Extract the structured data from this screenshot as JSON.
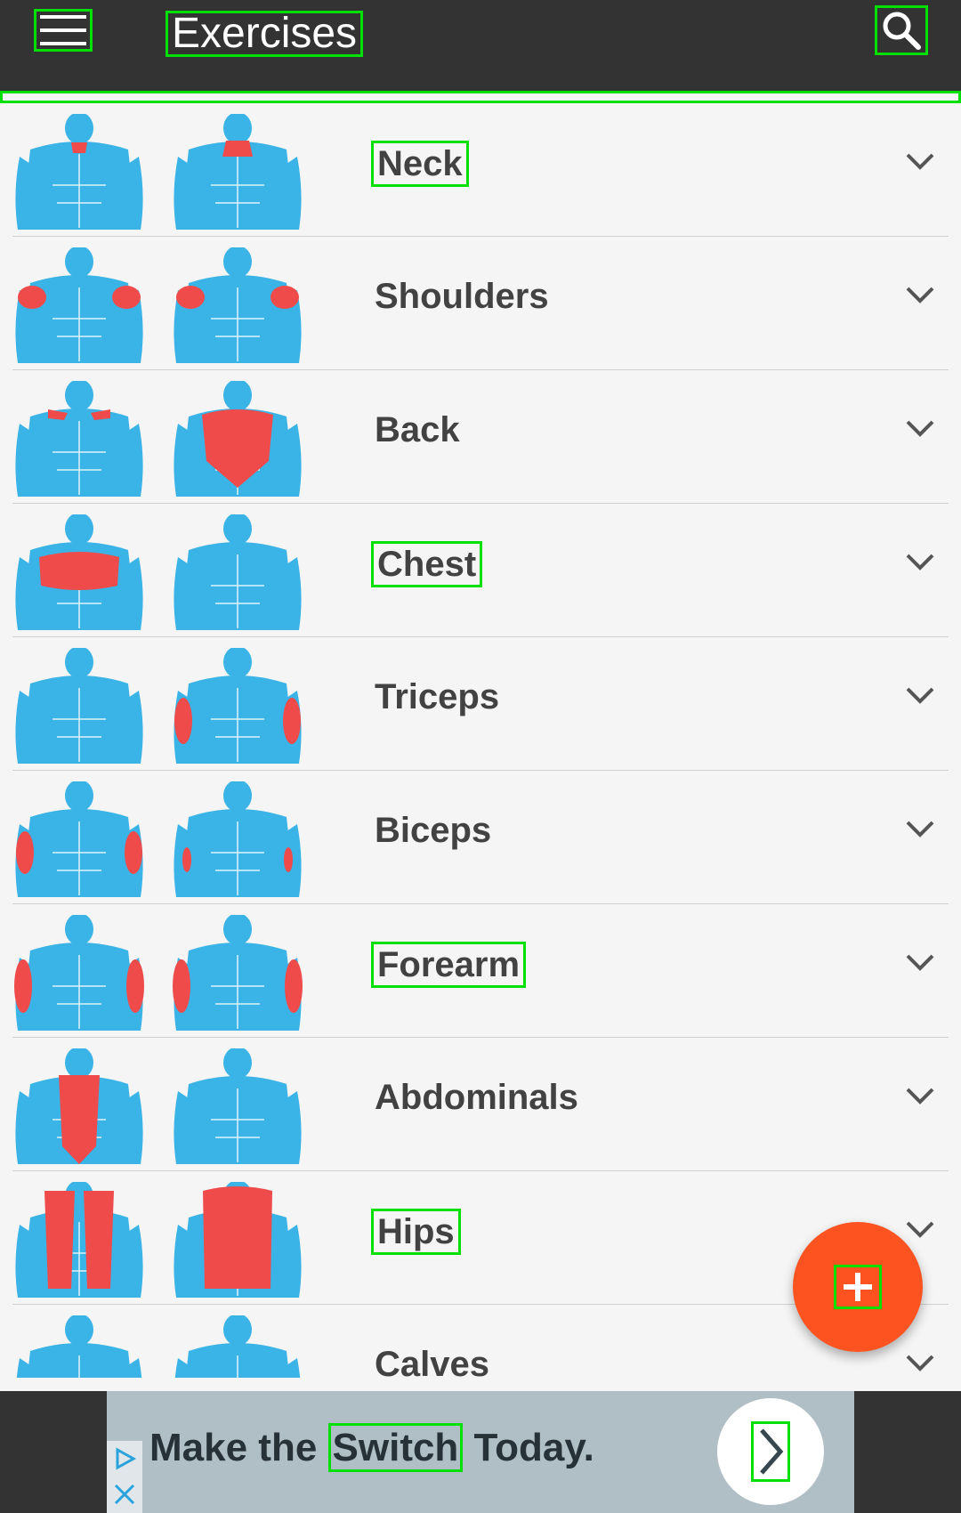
{
  "app_bar": {
    "title": "Exercises",
    "menu_icon": "hamburger-menu-icon",
    "search_icon": "search-icon"
  },
  "muscle_groups": [
    {
      "label": "Neck"
    },
    {
      "label": "Shoulders"
    },
    {
      "label": "Back"
    },
    {
      "label": "Chest"
    },
    {
      "label": "Triceps"
    },
    {
      "label": "Biceps"
    },
    {
      "label": "Forearm"
    },
    {
      "label": "Abdominals"
    },
    {
      "label": "Hips"
    },
    {
      "label": "Calves"
    }
  ],
  "fab": {
    "icon": "plus-icon"
  },
  "ad": {
    "text_before": "Make the ",
    "text_highlight": "Switch",
    "text_after": " Today.",
    "play_icon": "ad-choices-icon",
    "close_icon": "close-icon",
    "arrow_icon": "chevron-right-icon"
  },
  "colors": {
    "app_bar": "#333333",
    "body_blue": "#3ab3e6",
    "muscle_red": "#ef4b4b",
    "fab": "#fc5320",
    "ad_bg": "#b0bec5"
  }
}
